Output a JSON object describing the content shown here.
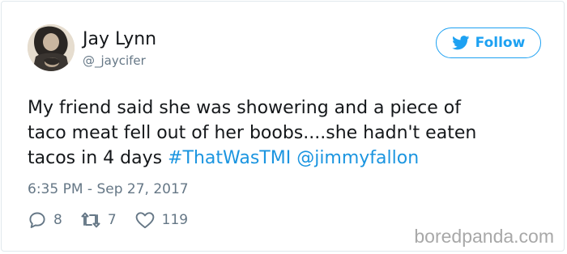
{
  "tweet": {
    "user": {
      "name": "Jay Lynn",
      "handle": "@_jaycifer",
      "avatar": "profile-photo"
    },
    "follow_button": {
      "label": "Follow",
      "icon": "twitter-bird-icon",
      "color": "#1da1f2"
    },
    "text": {
      "line1": "My friend said she was showering and a piece of",
      "line2": "taco meat fell out of her boobs....she hadn't eaten",
      "line3_prefix": "tacos in 4 days ",
      "hashtag": "#ThatWasTMI",
      "mention": "@jimmyfallon",
      "link_color": "#1b95e0"
    },
    "timestamp": "6:35 PM - Sep 27, 2017",
    "actions": {
      "replies": {
        "icon": "reply-icon",
        "count": "8"
      },
      "retweets": {
        "icon": "retweet-icon",
        "count": "7"
      },
      "likes": {
        "icon": "heart-icon",
        "count": "119"
      }
    }
  },
  "watermark": "boredpanda.com"
}
